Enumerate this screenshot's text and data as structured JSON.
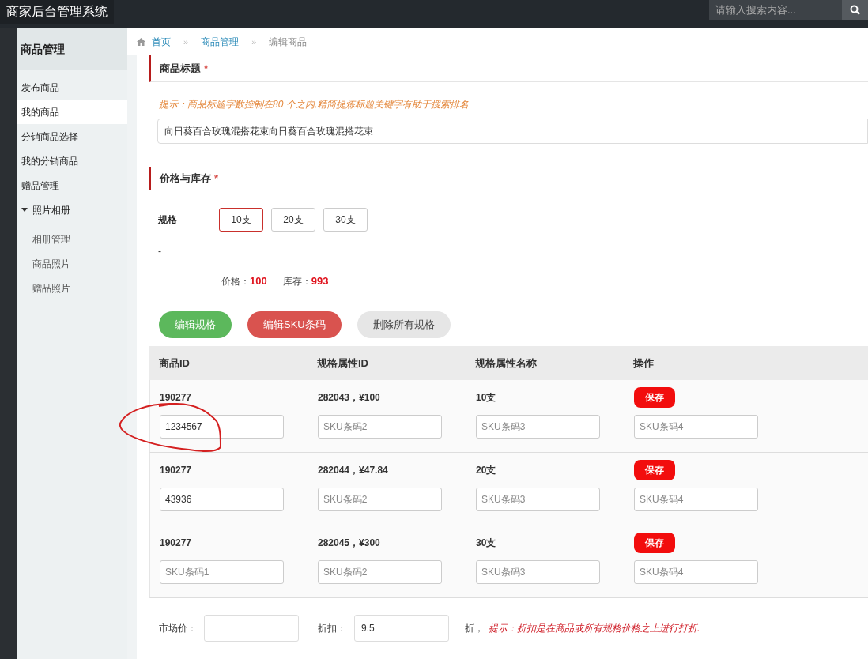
{
  "topbar": {
    "title": "商家后台管理系统",
    "search": {
      "placeholder": "请输入搜索内容..."
    }
  },
  "sidebar": {
    "header": "商品管理",
    "items": [
      {
        "label": "发布商品",
        "selected": false
      },
      {
        "label": "我的商品",
        "selected": true
      },
      {
        "label": "分销商品选择",
        "selected": false
      },
      {
        "label": "我的分销商品",
        "selected": false
      },
      {
        "label": "赠品管理",
        "selected": false
      },
      {
        "label": "照片相册",
        "selected": false,
        "expanded": true,
        "children": [
          {
            "label": "相册管理",
            "selected": false
          },
          {
            "label": "商品照片",
            "selected": false
          },
          {
            "label": "赠品照片",
            "selected": false
          }
        ]
      }
    ]
  },
  "breadcrumb": [
    {
      "label": "首页",
      "link": true
    },
    {
      "separator": "»",
      "label": "商品管理",
      "link": true
    },
    {
      "separator": "»",
      "label": "编辑商品",
      "link": false
    }
  ],
  "title_section": {
    "heading": "商品标题",
    "required_mark": "*",
    "hint": "提示：商品标题字数控制在80 个之内,精简提炼标题关键字有助于搜索排名",
    "value": "向日葵百合玫瑰混搭花束向日葵百合玫瑰混搭花束"
  },
  "price_section": {
    "heading": "价格与库存",
    "required_mark": "*",
    "spec_label": "规格",
    "specs": [
      {
        "label": "10支",
        "selected": true
      },
      {
        "label": "20支",
        "selected": false
      },
      {
        "label": "30支",
        "selected": false
      }
    ],
    "dash": "-",
    "price_label": "价格：",
    "price": "100",
    "stock_label": "库存：",
    "stock": "993",
    "buttons": [
      {
        "label": "编辑规格",
        "kind": "green"
      },
      {
        "label": "编辑SKU条码",
        "kind": "red"
      },
      {
        "label": "删除所有规格",
        "kind": "grey"
      }
    ]
  },
  "table": {
    "columns": [
      "商品ID",
      "规格属性ID",
      "规格属性名称",
      "操作"
    ],
    "rows": [
      {
        "product_id": "190277",
        "spec_id": "282043，¥100",
        "spec_name": "10支",
        "action": "保存",
        "fields": [
          {
            "value": "1234567"
          },
          {
            "placeholder": "SKU条码2"
          },
          {
            "placeholder": "SKU条码3"
          },
          {
            "placeholder": "SKU条码4"
          }
        ]
      },
      {
        "product_id": "190277",
        "spec_id": "282044，¥47.84",
        "spec_name": "20支",
        "action": "保存",
        "fields": [
          {
            "value": "43936"
          },
          {
            "placeholder": "SKU条码2"
          },
          {
            "placeholder": "SKU条码3"
          },
          {
            "placeholder": "SKU条码4"
          }
        ]
      },
      {
        "product_id": "190277",
        "spec_id": "282045，¥300",
        "spec_name": "30支",
        "action": "保存",
        "fields": [
          {
            "placeholder": "SKU条码1"
          },
          {
            "placeholder": "SKU条码2"
          },
          {
            "placeholder": "SKU条码3"
          },
          {
            "placeholder": "SKU条码4"
          }
        ]
      }
    ]
  },
  "bottom": {
    "market_price_label": "市场价：",
    "discount_label": "折扣：",
    "discount": "9.5",
    "discount_unit": "折，",
    "discount_hint": "提示：折扣是在商品或所有规格价格之上进行打折."
  }
}
